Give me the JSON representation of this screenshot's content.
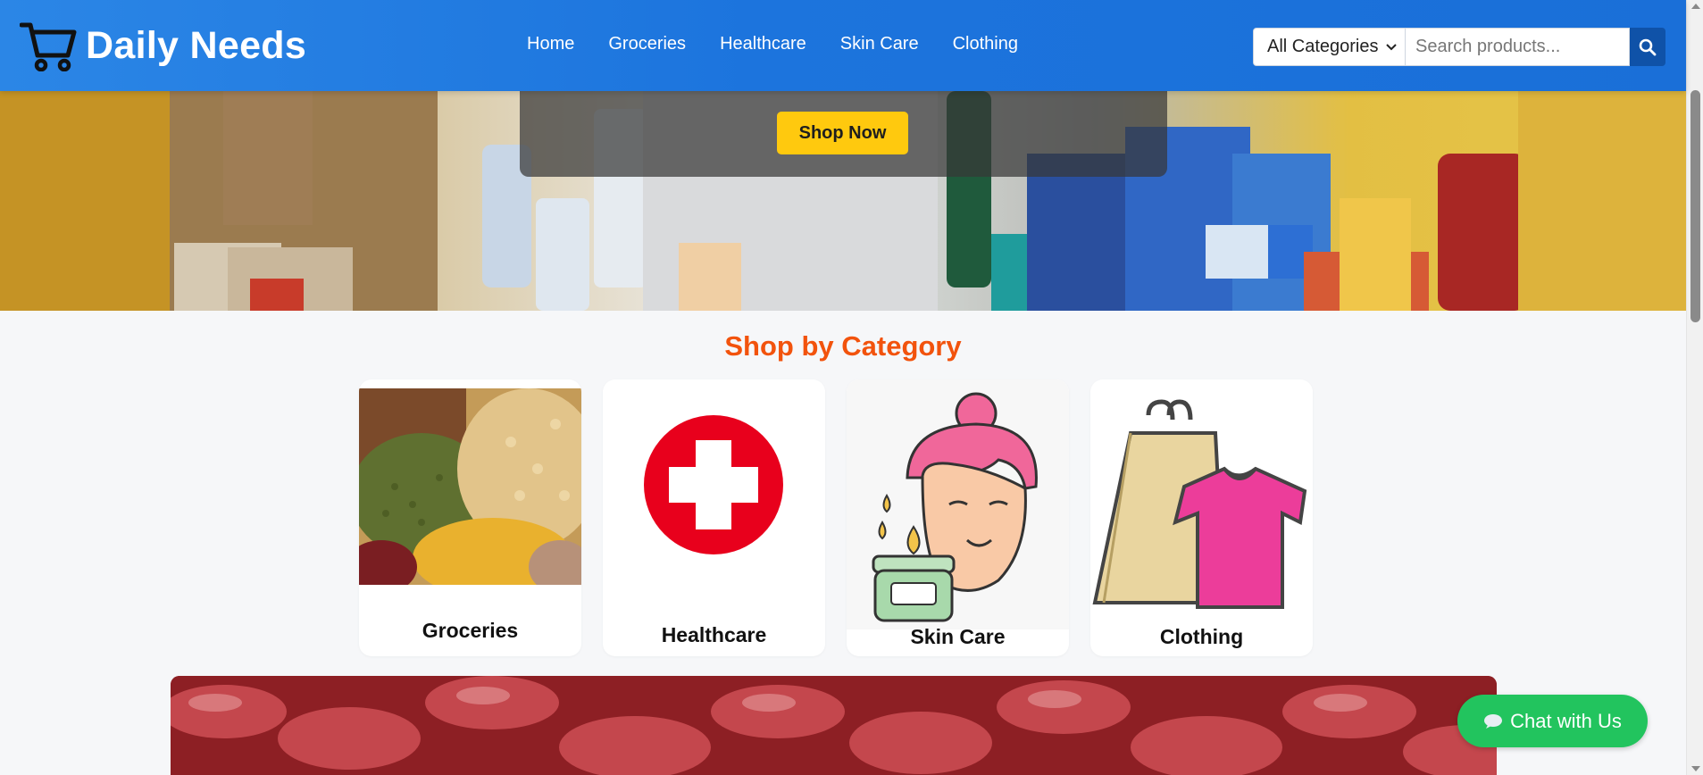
{
  "header": {
    "brand": "Daily Needs",
    "logo_icon": "cart-icon",
    "nav": [
      {
        "label": "Home"
      },
      {
        "label": "Groceries"
      },
      {
        "label": "Healthcare"
      },
      {
        "label": "Skin Care"
      },
      {
        "label": "Clothing"
      }
    ],
    "search": {
      "category_selected": "All Categories",
      "placeholder": "Search products...",
      "button_icon": "search-icon"
    },
    "colors": {
      "bar": "#1c74dd",
      "search_button": "#0f52a8"
    }
  },
  "hero": {
    "cta_label": "Shop Now",
    "cta_color": "#ffc90e"
  },
  "categories": {
    "title": "Shop by Category",
    "title_color": "#f2530d",
    "items": [
      {
        "label": "Groceries",
        "icon": "lentils-image"
      },
      {
        "label": "Healthcare",
        "icon": "medical-cross-icon"
      },
      {
        "label": "Skin Care",
        "icon": "skincare-face-icon"
      },
      {
        "label": "Clothing",
        "icon": "shopping-bag-shirt-icon"
      }
    ]
  },
  "chat": {
    "label": "Chat with Us",
    "icon": "chat-bubble-icon",
    "color": "#22c45e"
  }
}
